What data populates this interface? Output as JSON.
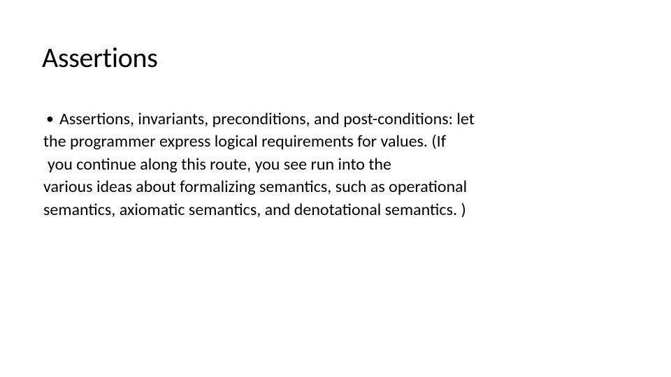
{
  "slide": {
    "title": "Assertions",
    "bullet": {
      "marker": "•",
      "line1": "Assertions, invariants, preconditions, and post-conditions: let"
    },
    "body": {
      "line2": "the programmer express logical requirements for values. (If",
      "line3": " you continue along this route, you see run into  the",
      "line4": "various ideas about formalizing semantics, such as operational",
      "line5": "semantics, axiomatic semantics, and denotational semantics. )"
    }
  }
}
